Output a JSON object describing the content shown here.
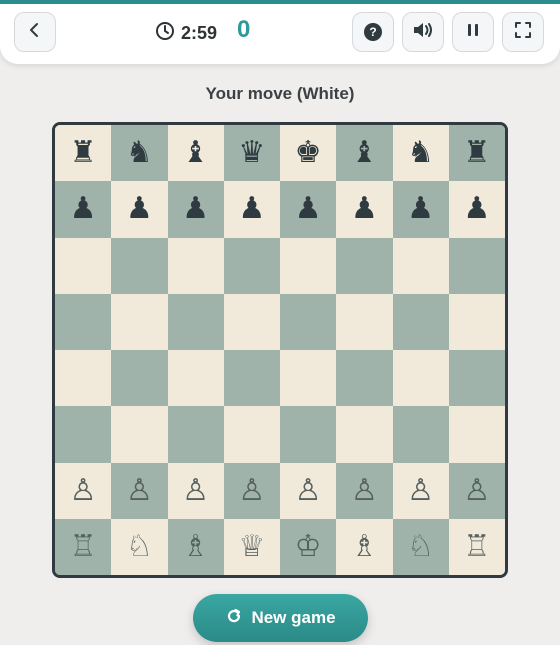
{
  "header": {
    "timer": "2:59",
    "score": "0",
    "icons": {
      "back": "chevron-left-icon",
      "clock": "clock-icon",
      "help": "help-icon",
      "sound": "speaker-icon",
      "pause": "pause-icon",
      "fullscreen": "fullscreen-icon"
    },
    "help_label": "?"
  },
  "status": "Your move (White)",
  "board": {
    "ranks": [
      [
        "♜",
        "♞",
        "♝",
        "♛",
        "♚",
        "♝",
        "♞",
        "♜"
      ],
      [
        "♟",
        "♟",
        "♟",
        "♟",
        "♟",
        "♟",
        "♟",
        "♟"
      ],
      [
        "",
        "",
        "",
        "",
        "",
        "",
        "",
        ""
      ],
      [
        "",
        "",
        "",
        "",
        "",
        "",
        "",
        ""
      ],
      [
        "",
        "",
        "",
        "",
        "",
        "",
        "",
        ""
      ],
      [
        "",
        "",
        "",
        "",
        "",
        "",
        "",
        ""
      ],
      [
        "♙",
        "♙",
        "♙",
        "♙",
        "♙",
        "♙",
        "♙",
        "♙"
      ],
      [
        "♖",
        "♘",
        "♗",
        "♕",
        "♔",
        "♗",
        "♘",
        "♖"
      ]
    ]
  },
  "footer": {
    "new_game_label": "New game",
    "new_game_icon": "refresh-icon"
  },
  "colors": {
    "accent": "#2b8e8d",
    "light_square": "#f1eadb",
    "dark_square": "#9fb3aa",
    "border": "#2f3b40"
  }
}
